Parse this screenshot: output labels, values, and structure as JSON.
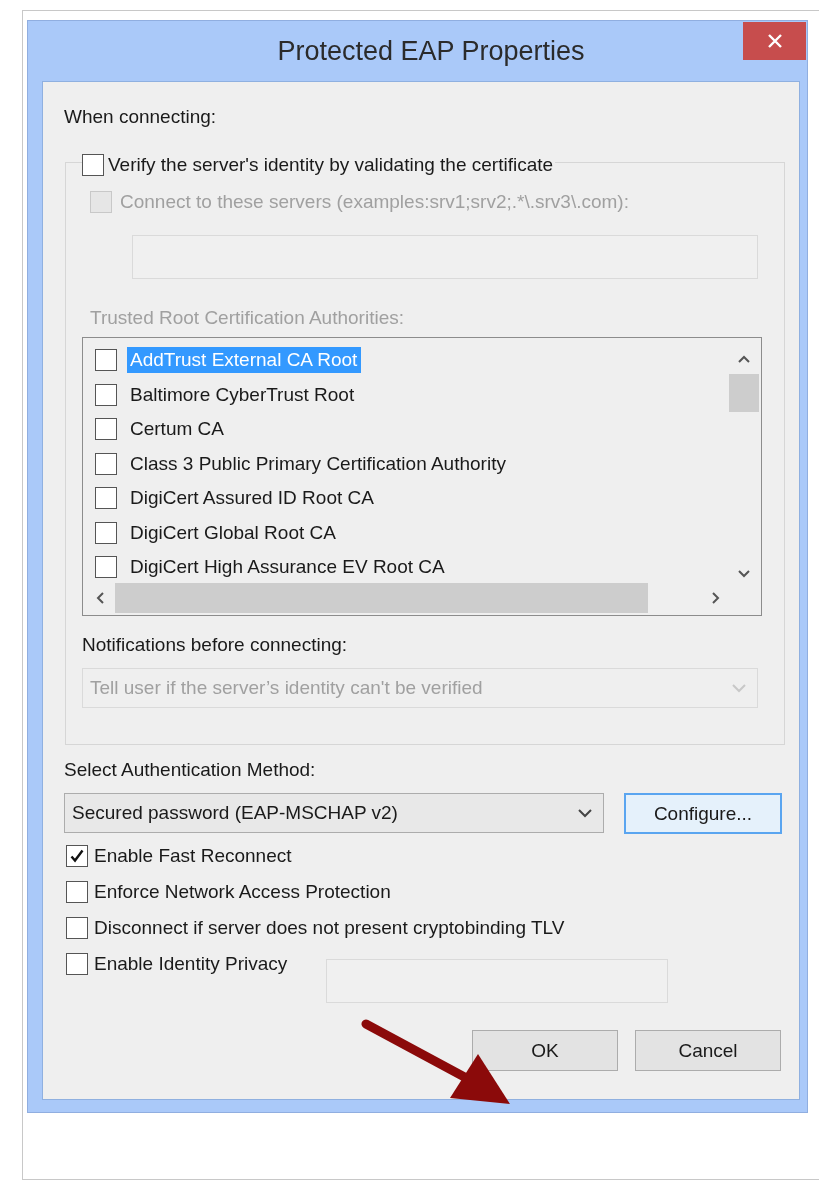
{
  "window": {
    "title": "Protected EAP Properties"
  },
  "when_connecting_label": "When connecting:",
  "verify_server": {
    "label": "Verify the server's identity by validating the certificate",
    "checked": false
  },
  "connect_servers": {
    "label": "Connect to these servers (examples:srv1;srv2;.*\\.srv3\\.com):",
    "checked": false,
    "disabled": true
  },
  "servers_field": {
    "disabled": true
  },
  "trusted_ca": {
    "label": "Trusted Root Certification Authorities:",
    "disabled": true,
    "items": [
      {
        "name": "AddTrust External CA Root",
        "checked": false,
        "selected": true
      },
      {
        "name": "Baltimore CyberTrust Root",
        "checked": false,
        "selected": false
      },
      {
        "name": "Certum CA",
        "checked": false,
        "selected": false
      },
      {
        "name": "Class 3 Public Primary Certification Authority",
        "checked": false,
        "selected": false
      },
      {
        "name": "DigiCert Assured ID Root CA",
        "checked": false,
        "selected": false
      },
      {
        "name": "DigiCert Global Root CA",
        "checked": false,
        "selected": false
      },
      {
        "name": "DigiCert High Assurance EV Root CA",
        "checked": false,
        "selected": false
      }
    ]
  },
  "notifications": {
    "label": "Notifications before connecting:",
    "value": "Tell user if the server’s identity can't be verified",
    "disabled": true
  },
  "auth_method": {
    "label": "Select Authentication Method:",
    "value": "Secured password (EAP-MSCHAP v2)"
  },
  "configure_button": {
    "label": "Configure...",
    "focused": true
  },
  "options": [
    {
      "kind": "checkbox",
      "label": "Enable Fast Reconnect",
      "checked": true
    },
    {
      "kind": "checkbox",
      "label": "Enforce Network Access Protection",
      "checked": false
    },
    {
      "kind": "checkbox",
      "label": "Disconnect if server does not present cryptobinding TLV",
      "checked": false
    },
    {
      "kind": "checkbox_field",
      "label": "Enable Identity Privacy",
      "checked": false,
      "field_disabled": true
    }
  ],
  "buttons": [
    {
      "label": "OK"
    },
    {
      "label": "Cancel"
    }
  ]
}
